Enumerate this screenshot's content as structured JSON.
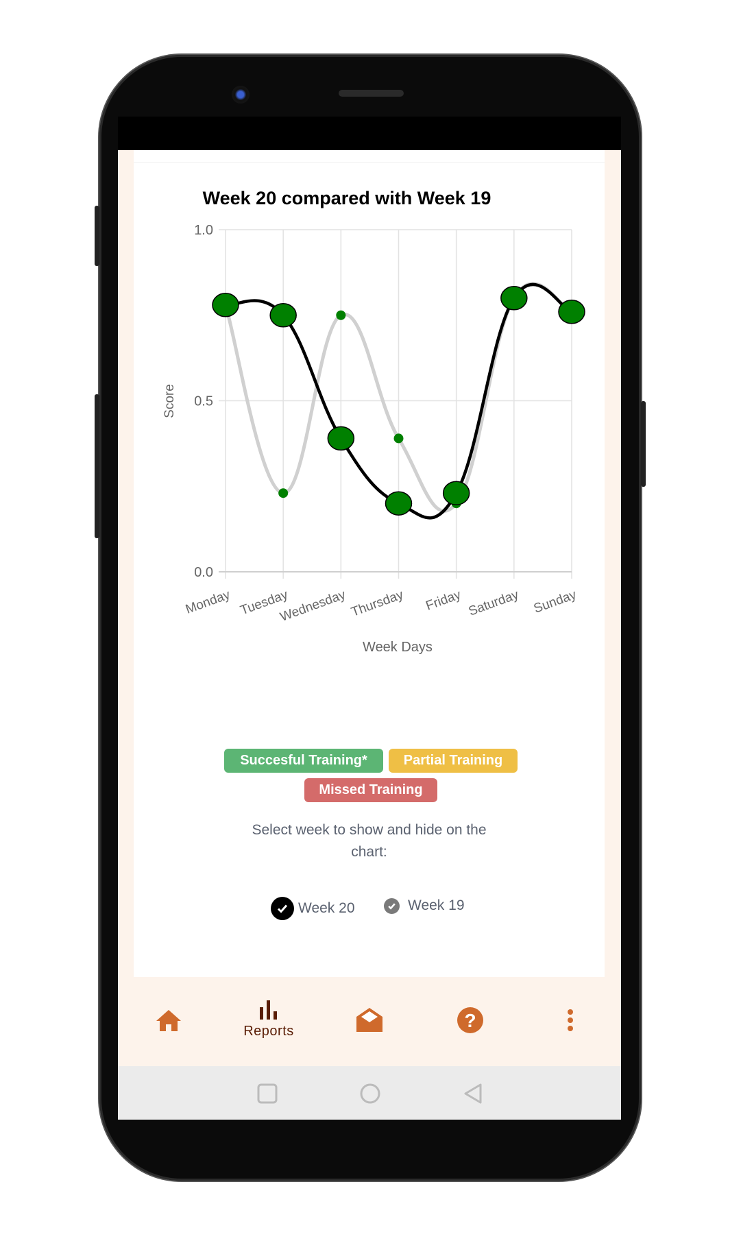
{
  "chart_data": {
    "type": "line",
    "title": "Week 20 compared with Week 19",
    "xlabel": "Week Days",
    "ylabel": "Score",
    "categories": [
      "Monday",
      "Tuesday",
      "Wednesday",
      "Thursday",
      "Friday",
      "Saturday",
      "Sunday"
    ],
    "ylim": [
      0,
      1
    ],
    "yticks": [
      "0.0",
      "0.5",
      "1.0"
    ],
    "grid": true,
    "series": [
      {
        "name": "Week 19",
        "values": [
          0.78,
          0.23,
          0.75,
          0.39,
          0.2,
          0.8,
          0.76
        ],
        "line_color": "#d0d0d0",
        "point_color": "#008000"
      },
      {
        "name": "Week 20",
        "values": [
          0.78,
          0.75,
          0.39,
          0.2,
          0.23,
          0.8,
          0.76
        ],
        "line_color": "#000000",
        "point_color": "#008000"
      }
    ]
  },
  "badges": [
    {
      "label": "Succesful Training*",
      "color": "#5cb574"
    },
    {
      "label": "Partial Training",
      "color": "#efbf45"
    },
    {
      "label": "Missed Training",
      "color": "#d46b6a"
    }
  ],
  "hint": {
    "line1": "Select week to show and hide on the",
    "line2": "chart:"
  },
  "week_toggles": [
    {
      "label": "Week 20",
      "checked": true,
      "color": "#000000"
    },
    {
      "label": "Week 19",
      "checked": true,
      "color": "#7a7a7a"
    }
  ],
  "bottom_nav": [
    {
      "icon": "home-icon"
    },
    {
      "icon": "bar-chart-icon",
      "label": "Reports",
      "active": true
    },
    {
      "icon": "envelope-open-icon"
    },
    {
      "icon": "help-circle-icon"
    },
    {
      "icon": "more-vertical-icon"
    }
  ],
  "colors": {
    "accent": "#cf6a2c",
    "active": "#5a1d05",
    "background": "#fdf3eb"
  }
}
